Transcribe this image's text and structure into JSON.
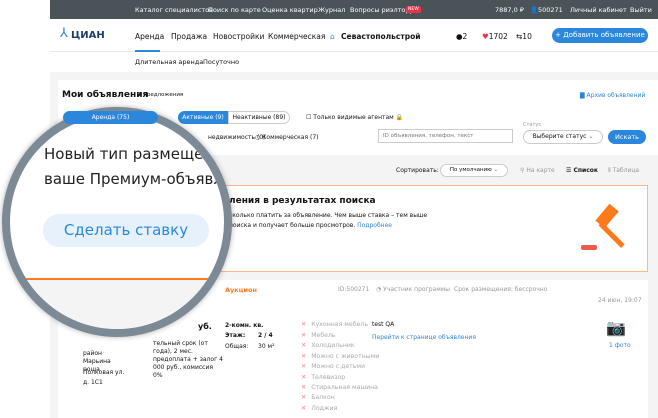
{
  "topbar": {
    "links": [
      "Каталог специалистов",
      "Поиск по карте",
      "Оценка квартир",
      "Журнал",
      "Вопросы риэлтору"
    ],
    "new_badge": "NEW",
    "balance": "7887,0 ₽",
    "user_id": "500271",
    "cabinet": "Личный кабинет",
    "logout": "Выйти"
  },
  "header": {
    "logo": "ЦИАН",
    "nav": [
      "Аренда",
      "Продажа",
      "Новостройки",
      "Коммерческая",
      "Севастопольстрой"
    ],
    "notifications": "2",
    "favorites": "1702",
    "compare": "10",
    "add_button": "+ Добавить объявление"
  },
  "subnav": [
    "Длительная аренда",
    "Посуточно"
  ],
  "my_ads": {
    "title": "Мои объявления",
    "count": "2 предложения",
    "archive": "Архив объявлений",
    "tab_rent": "Аренда (75)",
    "active": "Активные (9)",
    "inactive": "Неактивные (89)",
    "only_agents": "Только видимые агентам",
    "type_residential": "недвижимость (0)",
    "type_commercial": "Коммерческая (7)",
    "search_placeholder": "ID объявления, телефон, текст",
    "status_label": "Статус",
    "status_value": "Выберите статус",
    "search_button": "Искать"
  },
  "toolbar": {
    "sort_label": "Сортировать:",
    "sort_value": "По умолчанию",
    "map": "На карте",
    "list": "Список",
    "table": "Таблица"
  },
  "banner": {
    "title": "ления в результатах поиска",
    "line1": "сколько платить за объявление. Чем выше ставка – тем выше",
    "line2": "поиска и получает больше просмотров.",
    "more": "Подробнее"
  },
  "lens": {
    "line1": "Новый тип размеще",
    "line2": "ваше Премиум-объявл",
    "button": "Сделать ставку"
  },
  "listing": {
    "auction": "Аукцион",
    "id": "ID:500271",
    "program": "Участник программы",
    "term": "Срок размещения: бессрочно",
    "date": "24 июн, 19:07",
    "price": "уб.",
    "price_desc": "тельный срок (от года), 2 мес. предоплата + залог 4 000 руб., комиссия 0%",
    "address": [
      "район Марьина роща",
      "Полковая ул.",
      "д. 1С1"
    ],
    "rooms": "2-комн. кв.",
    "floor_label": "Этаж:",
    "floor": "2 / 4",
    "area_label": "Общая:",
    "area": "30 м²",
    "features": [
      "Кухонная мебель",
      "Мебель",
      "Холодильник",
      "Можно с животными",
      "Можно с детьми",
      "Телевизор",
      "Стиральная машина",
      "Балкон",
      "Лоджия"
    ],
    "comment": "test QA",
    "goto": "Перейти к странице объявления",
    "photos": "1 фото"
  },
  "colors": {
    "accent": "#2b87db",
    "orange": "#ff7a1a",
    "topbar": "#4a5358"
  }
}
